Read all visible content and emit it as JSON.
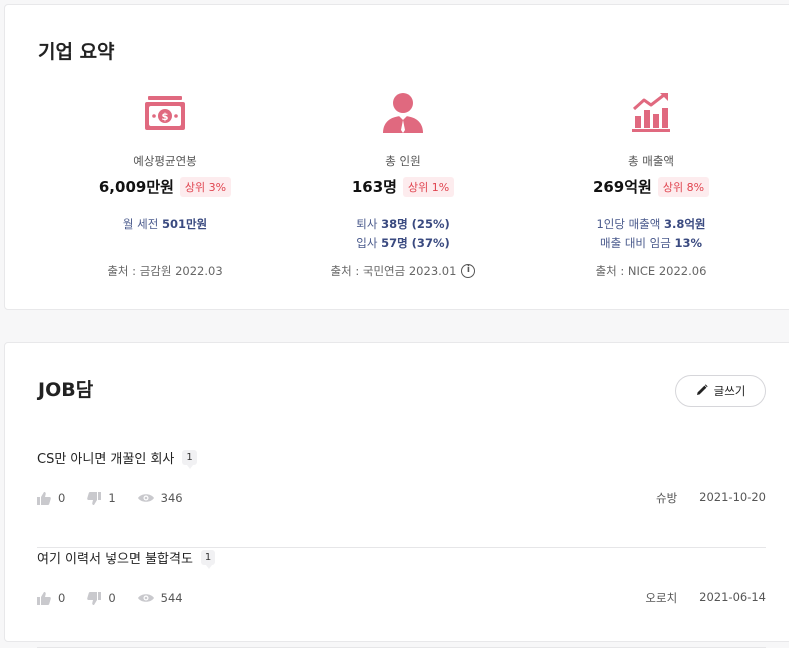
{
  "summary": {
    "title": "기업 요약",
    "salary": {
      "label": "예상평균연봉",
      "value": "6,009만원",
      "badge": "상위 3%",
      "sub_prefix": "월 세전 ",
      "sub_value": "501만원",
      "source": "출처 : 금감원 2022.03"
    },
    "headcount": {
      "label": "총 인원",
      "value": "163명",
      "badge": "상위 1%",
      "leave_prefix": "퇴사 ",
      "leave_value": "38명 (25%)",
      "join_prefix": "입사 ",
      "join_value": "57명 (37%)",
      "source": "출처 : 국민연금 2023.01",
      "info_glyph": "i"
    },
    "revenue": {
      "label": "총 매출액",
      "value": "269억원",
      "badge": "상위 8%",
      "per_prefix": "1인당 매출액 ",
      "per_value": "3.8억원",
      "ratio_prefix": "매출 대비 임금 ",
      "ratio_value": "13%",
      "source": "출처 : NICE 2022.06"
    },
    "icon_color": "#e0697f"
  },
  "jobdam": {
    "title": "JOB담",
    "write_label": "글쓰기",
    "posts": [
      {
        "title": "CS만 아니면 개꿀인 회사",
        "comments": "1",
        "likes": "0",
        "dislikes": "1",
        "views": "346",
        "author": "슈방",
        "date": "2021-10-20"
      },
      {
        "title": "여기 이력서 넣으면 불합격도",
        "comments": "1",
        "likes": "0",
        "dislikes": "0",
        "views": "544",
        "author": "오로치",
        "date": "2021-06-14"
      }
    ]
  }
}
